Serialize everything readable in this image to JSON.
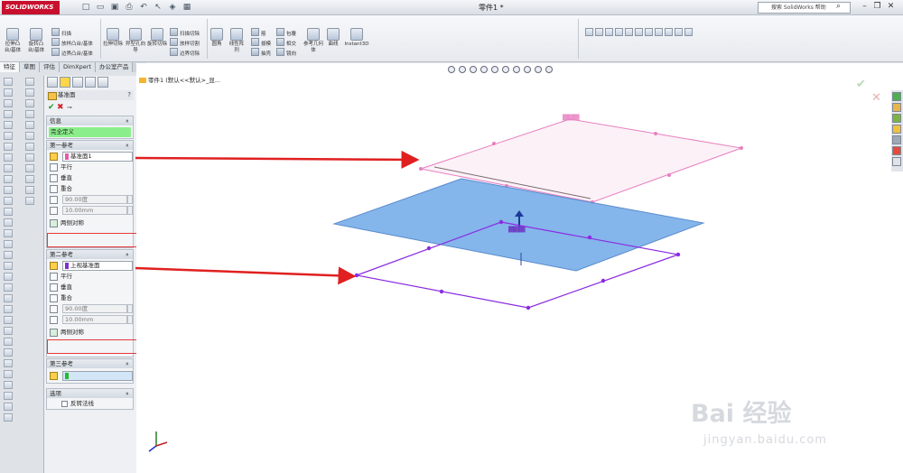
{
  "app": {
    "logo_text": "SOLIDWORKS",
    "document_title": "零件1 *",
    "search_placeholder": "搜索 SolidWorks 帮助"
  },
  "ribbon": {
    "features": [
      {
        "label": "拉伸凸台/基体"
      },
      {
        "label": "旋转凸台/基体"
      },
      {
        "label": "扫描"
      },
      {
        "label": "放样凸台/基体"
      },
      {
        "label": "边界凸台/基体"
      },
      {
        "label": "拉伸切除"
      },
      {
        "label": "异型孔向导"
      },
      {
        "label": "旋转切除"
      },
      {
        "label": "扫描切除"
      },
      {
        "label": "放样切割"
      },
      {
        "label": "边界切除"
      },
      {
        "label": "圆角"
      },
      {
        "label": "线性阵列"
      },
      {
        "label": "筋"
      },
      {
        "label": "拔模"
      },
      {
        "label": "抽壳"
      },
      {
        "label": "包覆"
      },
      {
        "label": "相交"
      },
      {
        "label": "镜向"
      },
      {
        "label": "参考几何体"
      },
      {
        "label": "曲线"
      },
      {
        "label": "Instant3D"
      }
    ]
  },
  "tabs": [
    "特征",
    "草图",
    "评估",
    "DimXpert",
    "办公室产品"
  ],
  "property_manager": {
    "title": "基准面",
    "help": "?",
    "message_group": {
      "header": "信息",
      "status": "完全定义"
    },
    "first_reference": {
      "header": "第一参考",
      "selection": "基准面1",
      "selection_color": "#e85aa8",
      "options": [
        "平行",
        "垂直",
        "重合"
      ],
      "angle": "90.00度",
      "distance": "10.00mm",
      "symmetric": "两侧对称"
    },
    "second_reference": {
      "header": "第二参考",
      "selection": "上视基准面",
      "selection_color": "#7b2fd0",
      "options": [
        "平行",
        "垂直",
        "重合"
      ],
      "angle": "90.00度",
      "distance": "10.00mm",
      "symmetric": "两侧对称"
    },
    "third_reference": {
      "header": "第三参考",
      "selection_color": "#1fbf2a"
    },
    "options_group": {
      "header": "选项",
      "flip": "反转法线"
    }
  },
  "graphics": {
    "tree_text": "零件1 (默认<<默认>_显..."
  },
  "watermark": {
    "brand": "Bai 经验",
    "url": "jingyan.baidu.com"
  },
  "colors": {
    "plane_pink": "#e87fc0",
    "plane_purple": "#8a2be2",
    "plane_blue": "#6fa8e8",
    "arrow_red": "#e02020",
    "status_green": "#8aef8a"
  }
}
